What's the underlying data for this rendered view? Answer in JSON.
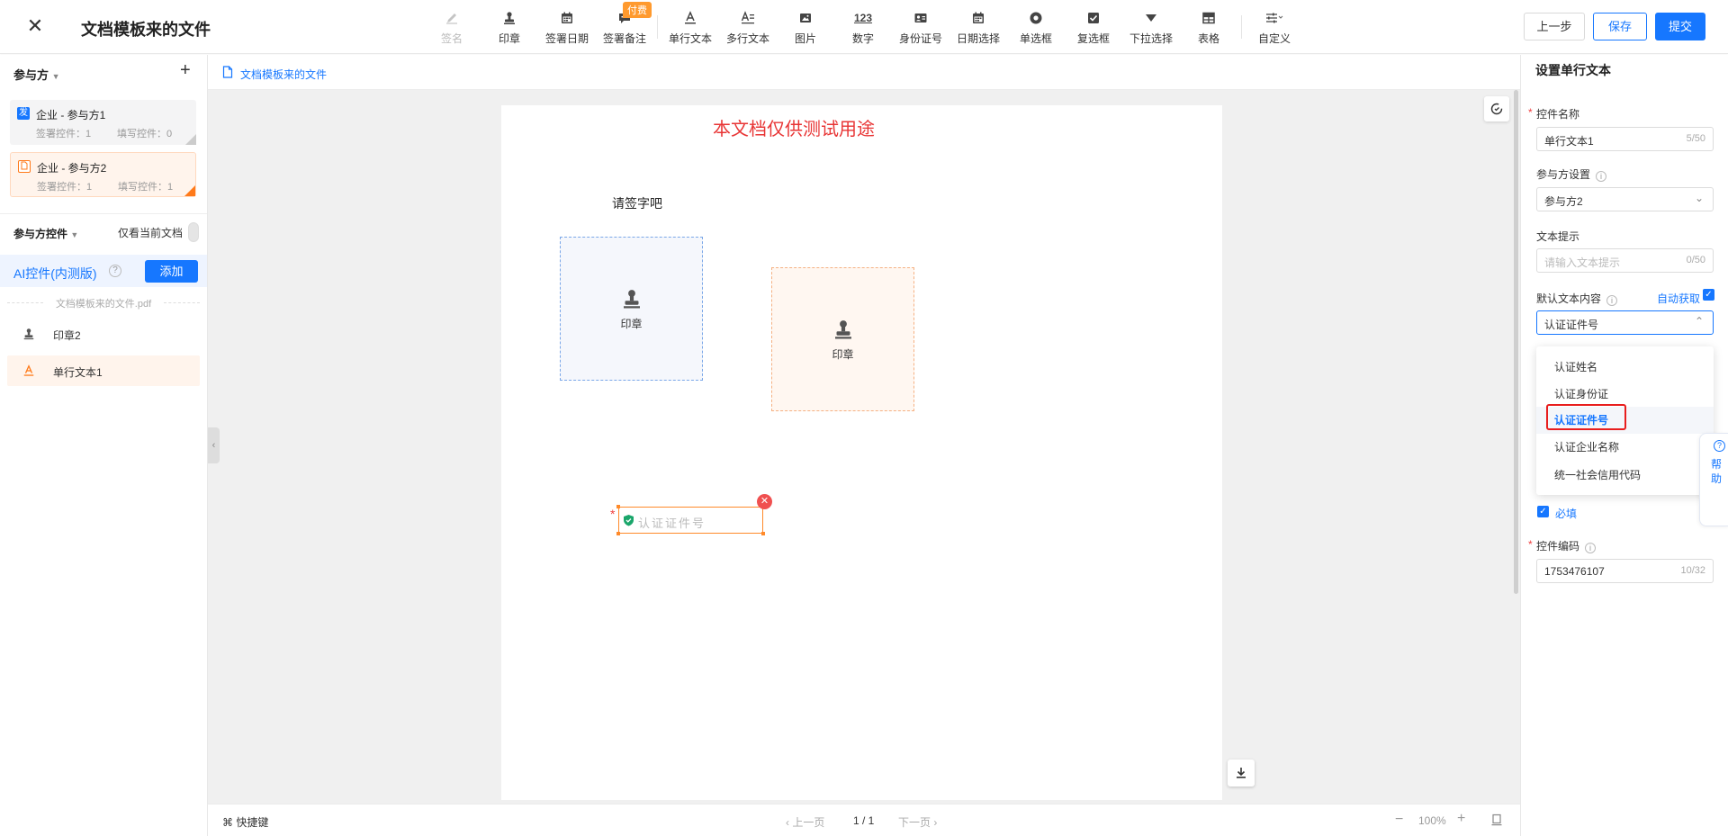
{
  "header": {
    "title": "文档模板来的文件",
    "close_glyph": "✕",
    "pay_badge": "付费",
    "tools": [
      {
        "label": "签名",
        "icon": "pen-icon",
        "disabled": true
      },
      {
        "label": "印章",
        "icon": "stamp-icon"
      },
      {
        "label": "签署日期",
        "icon": "calendar-icon"
      },
      {
        "label": "签署备注",
        "icon": "comment-icon"
      },
      {
        "label": "单行文本",
        "icon": "text-a-icon"
      },
      {
        "label": "多行文本",
        "icon": "multiline-text-icon"
      },
      {
        "label": "图片",
        "icon": "image-icon"
      },
      {
        "label": "数字",
        "icon": "number-icon",
        "glyph": "123"
      },
      {
        "label": "身份证号",
        "icon": "id-card-icon"
      },
      {
        "label": "日期选择",
        "icon": "date-picker-icon"
      },
      {
        "label": "单选框",
        "icon": "radio-icon"
      },
      {
        "label": "复选框",
        "icon": "checkbox-icon"
      },
      {
        "label": "下拉选择",
        "icon": "dropdown-icon"
      },
      {
        "label": "表格",
        "icon": "table-icon"
      },
      {
        "label": "自定义",
        "icon": "sliders-icon"
      }
    ],
    "prev_label": "上一步",
    "save_label": "保存",
    "submit_label": "提交"
  },
  "left": {
    "parties_title": "参与方",
    "parties": [
      {
        "badge": "发",
        "name": "企业 - 参与方1",
        "sign_count": "签署控件：1",
        "fill_count": "填写控件：0"
      },
      {
        "badge": "",
        "name": "企业 - 参与方2",
        "sign_count": "签署控件：1",
        "fill_count": "填写控件：1"
      }
    ],
    "controls_title": "参与方控件",
    "only_current": "仅看当前文档",
    "ai_label": "AI控件(内测版)",
    "ai_add": "添加",
    "file_name": "文档模板来的文件.pdf",
    "controls": [
      {
        "label": "印章2",
        "icon": "stamp-icon"
      },
      {
        "label": "单行文本1",
        "icon": "text-a-icon"
      }
    ]
  },
  "center": {
    "breadcrumb": "文档模板来的文件",
    "watermark": "本文档仅供测试用途",
    "sign_prompt": "请签字吧",
    "seal_label": "印章",
    "text_field_value": "认证证件号",
    "shortcut": "快捷键",
    "prev_page": "上一页",
    "page_indicator": "1 / 1",
    "next_page": "下一页",
    "zoom": "100%"
  },
  "right": {
    "title": "设置单行文本",
    "name_label": "控件名称",
    "name_value": "单行文本1",
    "name_count": "5/50",
    "party_label": "参与方设置",
    "party_value": "参与方2",
    "hint_label": "文本提示",
    "hint_placeholder": "请输入文本提示",
    "hint_count": "0/50",
    "default_label": "默认文本内容",
    "auto_get": "自动获取",
    "default_value": "认证证件号",
    "options": [
      "认证姓名",
      "认证身份证",
      "认证证件号",
      "认证企业名称",
      "统一社会信用代码"
    ],
    "selected_option": "认证证件号",
    "required_label": "必填",
    "code_label": "控件编码",
    "code_value": "1753476107",
    "code_count": "10/32",
    "help_text": "帮助"
  },
  "colors": {
    "primary": "#1677ff",
    "party2_accent": "#ff7a1a",
    "watermark": "#e83535",
    "highlight_outline": "#e81e1e"
  }
}
